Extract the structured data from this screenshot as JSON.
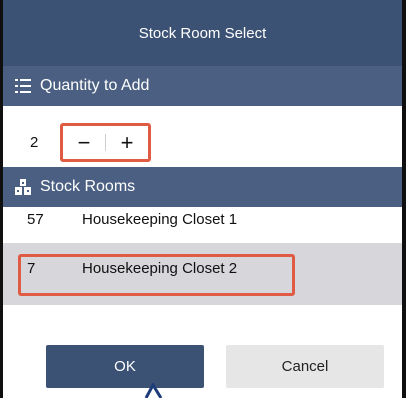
{
  "dialog": {
    "title": "Stock Room Select"
  },
  "quantity_section": {
    "header": "Quantity to Add",
    "icon": "list-icon",
    "value": "2",
    "decrement_label": "−",
    "increment_label": "+"
  },
  "rooms_section": {
    "header": "Stock Rooms",
    "icon": "building-icon",
    "rows": [
      {
        "number": "57",
        "name": "Housekeeping Closet 1",
        "selected": false
      },
      {
        "number": "7",
        "name": "Housekeeping Closet 2",
        "selected": true
      }
    ]
  },
  "buttons": {
    "ok_label": "OK",
    "cancel_label": "Cancel"
  },
  "colors": {
    "header_bg": "#3c5275",
    "section_bg": "#4a5f82",
    "highlight": "#e05b43",
    "selected_row": "#d6d6db",
    "cancel_bg": "#e6e6e6"
  }
}
